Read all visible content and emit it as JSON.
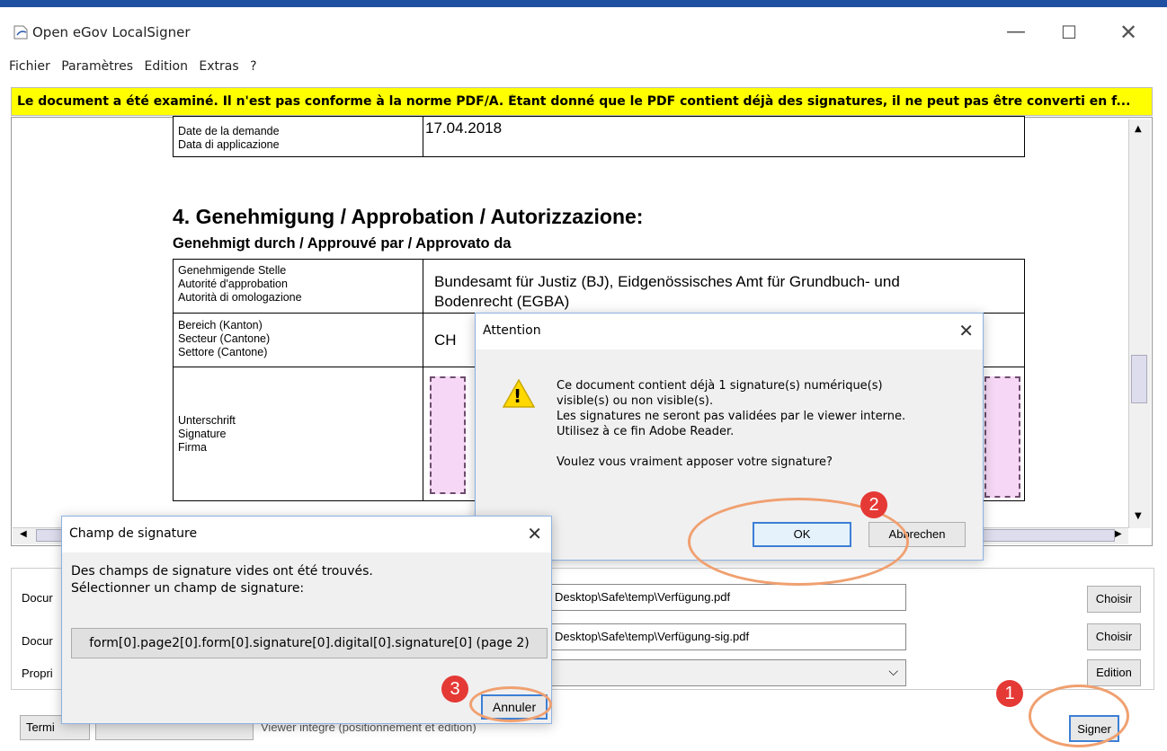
{
  "window": {
    "title": "Open eGov LocalSigner",
    "min": "—",
    "max": "☐",
    "close": "✕"
  },
  "menu": {
    "items": [
      "Fichier",
      "Paramètres",
      "Edition",
      "Extras",
      "?"
    ]
  },
  "banner": {
    "text": "Le document a été examiné. Il n'est pas conforme à la norme PDF/A. Étant donné que le PDF contient déjà des signatures, il ne peut pas être converti en f...",
    "color": "#ffff00"
  },
  "document": {
    "date_labels": [
      "Date de la demande",
      "Data di applicazione"
    ],
    "date_value": "17.04.2018",
    "section_heading": "4. Genehmigung / Approbation / Autorizzazione:",
    "section_sub": "Genehmigt durch / Approuvé par / Approvato da",
    "row1_labels": [
      "Genehmigende Stelle",
      "Autorité d'approbation",
      "Autorità di omologazione"
    ],
    "row1_value": [
      "Bundesamt für Justiz (BJ), Eidgenössisches Amt für Grundbuch- und",
      "Bodenrecht (EGBA)"
    ],
    "row2_labels": [
      "Bereich (Kanton)",
      "Secteur (Cantone)",
      "Settore (Cantone)"
    ],
    "row2_value": "CH",
    "row3_labels": [
      "Unterschrift",
      "Signature",
      "Firma"
    ]
  },
  "bottom": {
    "label1": "Docur",
    "label2": "Docur",
    "label3": "Propri",
    "path1": "Desktop\\Safe\\temp\\Verfügung.pdf",
    "path2": "Desktop\\Safe\\temp\\Verfügung-sig.pdf",
    "choose1": "Choisir",
    "choose2": "Choisir",
    "edit": "Edition",
    "sign": "Signer",
    "finish": "Termi",
    "viewer_text": "Viewer intégré (positionnement et édition)",
    "dropdown_chevron": "⌵"
  },
  "attention": {
    "title": "Attention",
    "icon_glyph": "!",
    "lines": [
      "Ce document contient déjà 1 signature(s) numérique(s)",
      "visible(s) ou non visible(s).",
      "Les signatures ne seront pas validées par le viewer interne.",
      "Utilisez à ce fin Adobe  Reader.",
      "",
      "Voulez vous vraiment apposer votre signature?"
    ],
    "ok": "OK",
    "cancel": "Abbrechen"
  },
  "champ": {
    "title": "Champ de signature",
    "line1": "Des champs de signature vides ont été trouvés.",
    "line2": "Sélectionner un champ de signature:",
    "field": "form[0].page2[0].form[0].signature[0].digital[0].signature[0] (page 2)",
    "cancel": "Annuler"
  },
  "badges": [
    "1",
    "2",
    "3"
  ],
  "colors": {
    "badge": "#e53935",
    "ring": "#f0a070",
    "sig_fill": "#f6d8f6",
    "taskbar": "#1f4fa0"
  }
}
